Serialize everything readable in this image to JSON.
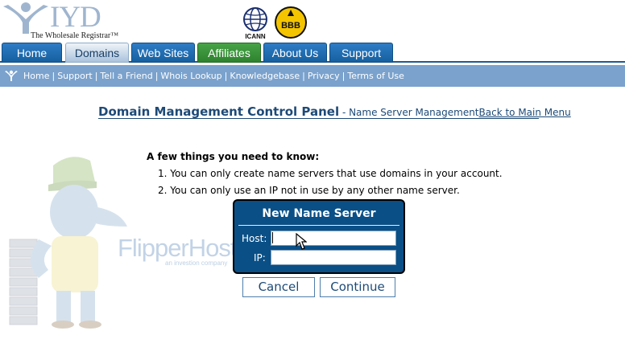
{
  "header": {
    "logo_text": "IYD",
    "tagline": "The Wholesale Registrar™",
    "icann_label": "ICANN",
    "bbb_label": "BBB"
  },
  "tabs": [
    {
      "label": "Home"
    },
    {
      "label": "Domains",
      "active": true
    },
    {
      "label": "Web Sites"
    },
    {
      "label": "Affiliates"
    },
    {
      "label": "About Us"
    },
    {
      "label": "Support"
    }
  ],
  "subnav": {
    "links": [
      "Home",
      "Support",
      "Tell a Friend",
      "Whois Lookup",
      "Knowledgebase",
      "Privacy",
      "Terms of Use"
    ],
    "separator": "|"
  },
  "panel": {
    "title": "Domain Management Control Panel",
    "subtitle": " - Name Server Management",
    "back_link": "Back to Main Menu"
  },
  "info": {
    "heading": "A few things you need to know:",
    "items": [
      "1. You can only create name servers that use domains in your account.",
      "2. You can only use an IP not in use by any other name server."
    ]
  },
  "watermark": {
    "brand": "FlipperHost",
    "tag": "an investion company"
  },
  "dialog": {
    "title": "New Name Server",
    "host_label": "Host:",
    "host_value": "",
    "ip_label": "IP:",
    "ip_value": ""
  },
  "buttons": {
    "cancel": "Cancel",
    "continue": "Continue"
  },
  "colors": {
    "tab_blue": "#15609f",
    "tab_green": "#2e832e",
    "subnav_bg": "#7aa2cd",
    "dialog_bg": "#0a4f86",
    "title_text": "#1d4a77"
  }
}
